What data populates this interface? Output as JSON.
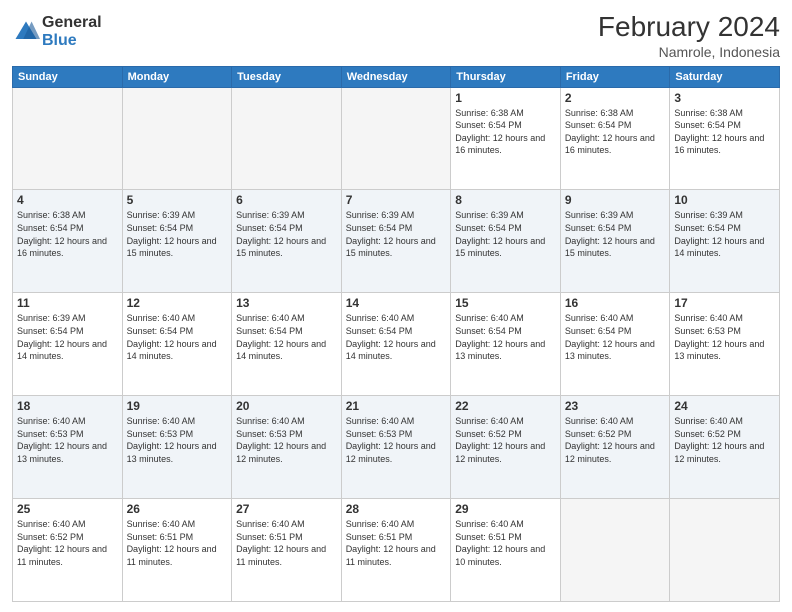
{
  "logo": {
    "general": "General",
    "blue": "Blue"
  },
  "title": "February 2024",
  "subtitle": "Namrole, Indonesia",
  "days_of_week": [
    "Sunday",
    "Monday",
    "Tuesday",
    "Wednesday",
    "Thursday",
    "Friday",
    "Saturday"
  ],
  "weeks": [
    [
      {
        "day": "",
        "info": ""
      },
      {
        "day": "",
        "info": ""
      },
      {
        "day": "",
        "info": ""
      },
      {
        "day": "",
        "info": ""
      },
      {
        "day": "1",
        "info": "Sunrise: 6:38 AM\nSunset: 6:54 PM\nDaylight: 12 hours and 16 minutes."
      },
      {
        "day": "2",
        "info": "Sunrise: 6:38 AM\nSunset: 6:54 PM\nDaylight: 12 hours and 16 minutes."
      },
      {
        "day": "3",
        "info": "Sunrise: 6:38 AM\nSunset: 6:54 PM\nDaylight: 12 hours and 16 minutes."
      }
    ],
    [
      {
        "day": "4",
        "info": "Sunrise: 6:38 AM\nSunset: 6:54 PM\nDaylight: 12 hours and 16 minutes."
      },
      {
        "day": "5",
        "info": "Sunrise: 6:39 AM\nSunset: 6:54 PM\nDaylight: 12 hours and 15 minutes."
      },
      {
        "day": "6",
        "info": "Sunrise: 6:39 AM\nSunset: 6:54 PM\nDaylight: 12 hours and 15 minutes."
      },
      {
        "day": "7",
        "info": "Sunrise: 6:39 AM\nSunset: 6:54 PM\nDaylight: 12 hours and 15 minutes."
      },
      {
        "day": "8",
        "info": "Sunrise: 6:39 AM\nSunset: 6:54 PM\nDaylight: 12 hours and 15 minutes."
      },
      {
        "day": "9",
        "info": "Sunrise: 6:39 AM\nSunset: 6:54 PM\nDaylight: 12 hours and 15 minutes."
      },
      {
        "day": "10",
        "info": "Sunrise: 6:39 AM\nSunset: 6:54 PM\nDaylight: 12 hours and 14 minutes."
      }
    ],
    [
      {
        "day": "11",
        "info": "Sunrise: 6:39 AM\nSunset: 6:54 PM\nDaylight: 12 hours and 14 minutes."
      },
      {
        "day": "12",
        "info": "Sunrise: 6:40 AM\nSunset: 6:54 PM\nDaylight: 12 hours and 14 minutes."
      },
      {
        "day": "13",
        "info": "Sunrise: 6:40 AM\nSunset: 6:54 PM\nDaylight: 12 hours and 14 minutes."
      },
      {
        "day": "14",
        "info": "Sunrise: 6:40 AM\nSunset: 6:54 PM\nDaylight: 12 hours and 14 minutes."
      },
      {
        "day": "15",
        "info": "Sunrise: 6:40 AM\nSunset: 6:54 PM\nDaylight: 12 hours and 13 minutes."
      },
      {
        "day": "16",
        "info": "Sunrise: 6:40 AM\nSunset: 6:54 PM\nDaylight: 12 hours and 13 minutes."
      },
      {
        "day": "17",
        "info": "Sunrise: 6:40 AM\nSunset: 6:53 PM\nDaylight: 12 hours and 13 minutes."
      }
    ],
    [
      {
        "day": "18",
        "info": "Sunrise: 6:40 AM\nSunset: 6:53 PM\nDaylight: 12 hours and 13 minutes."
      },
      {
        "day": "19",
        "info": "Sunrise: 6:40 AM\nSunset: 6:53 PM\nDaylight: 12 hours and 13 minutes."
      },
      {
        "day": "20",
        "info": "Sunrise: 6:40 AM\nSunset: 6:53 PM\nDaylight: 12 hours and 12 minutes."
      },
      {
        "day": "21",
        "info": "Sunrise: 6:40 AM\nSunset: 6:53 PM\nDaylight: 12 hours and 12 minutes."
      },
      {
        "day": "22",
        "info": "Sunrise: 6:40 AM\nSunset: 6:52 PM\nDaylight: 12 hours and 12 minutes."
      },
      {
        "day": "23",
        "info": "Sunrise: 6:40 AM\nSunset: 6:52 PM\nDaylight: 12 hours and 12 minutes."
      },
      {
        "day": "24",
        "info": "Sunrise: 6:40 AM\nSunset: 6:52 PM\nDaylight: 12 hours and 12 minutes."
      }
    ],
    [
      {
        "day": "25",
        "info": "Sunrise: 6:40 AM\nSunset: 6:52 PM\nDaylight: 12 hours and 11 minutes."
      },
      {
        "day": "26",
        "info": "Sunrise: 6:40 AM\nSunset: 6:51 PM\nDaylight: 12 hours and 11 minutes."
      },
      {
        "day": "27",
        "info": "Sunrise: 6:40 AM\nSunset: 6:51 PM\nDaylight: 12 hours and 11 minutes."
      },
      {
        "day": "28",
        "info": "Sunrise: 6:40 AM\nSunset: 6:51 PM\nDaylight: 12 hours and 11 minutes."
      },
      {
        "day": "29",
        "info": "Sunrise: 6:40 AM\nSunset: 6:51 PM\nDaylight: 12 hours and 10 minutes."
      },
      {
        "day": "",
        "info": ""
      },
      {
        "day": "",
        "info": ""
      }
    ]
  ]
}
